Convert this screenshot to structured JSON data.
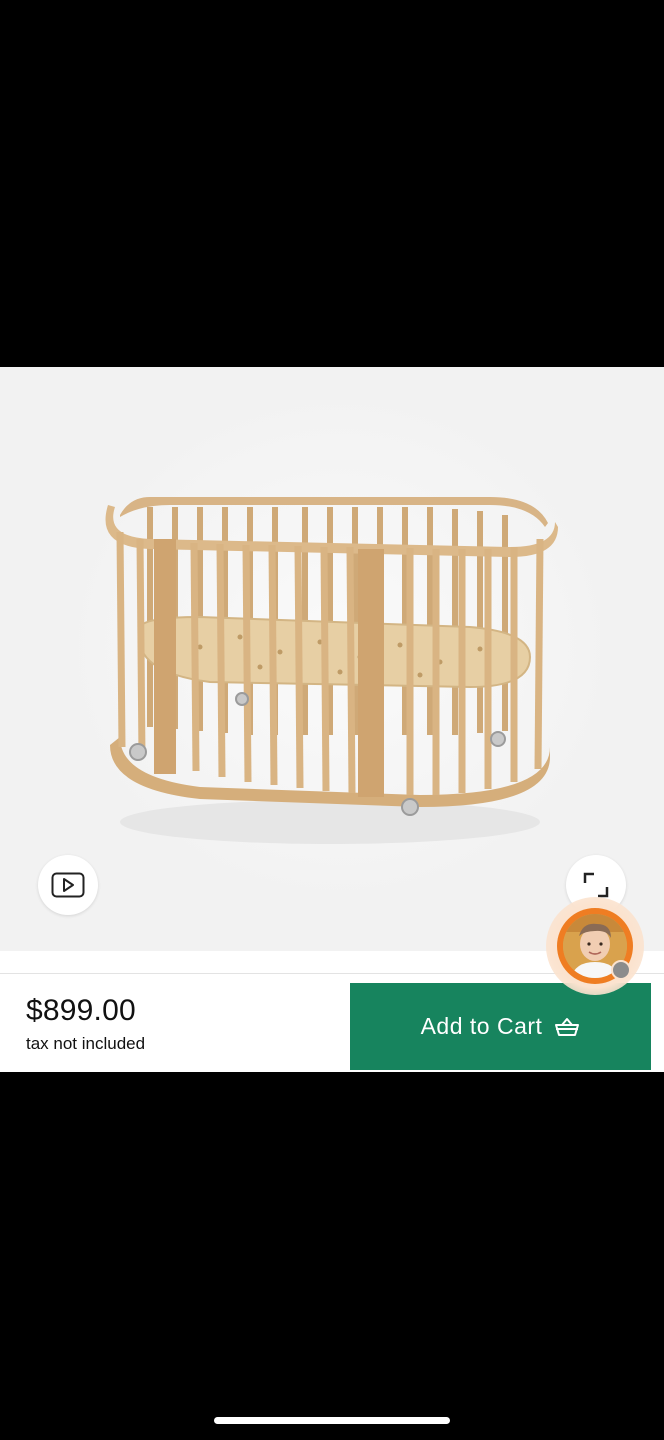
{
  "product": {
    "image_alt": "Oval wooden crib on caster wheels",
    "price": "$899.00",
    "tax_note": "tax not included"
  },
  "buttons": {
    "add_to_cart": "Add to Cart"
  },
  "icons": {
    "video": "play-icon",
    "expand": "expand-icon",
    "cart": "basket-icon"
  },
  "colors": {
    "accent": "#17845e",
    "avatar_ring": "#ef7d22"
  }
}
